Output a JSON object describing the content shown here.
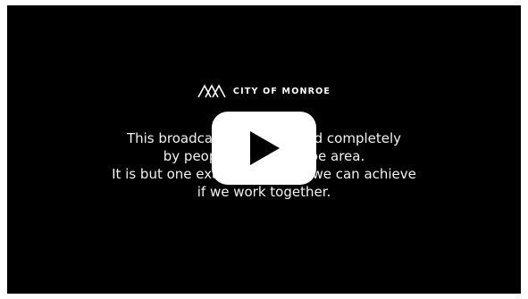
{
  "video": {
    "logo_text": "CITY OF MONROE",
    "logo_icon": "monroe-mountains-logo",
    "message_lines": [
      "This broadcast was produced completely",
      "by people in the Monroe area.",
      "It is but one example of what we can achieve",
      "if we work together."
    ],
    "play_icon": "play-icon",
    "colors": {
      "background": "#000000",
      "text": "#ffffff",
      "play_button": "#ffffff",
      "play_glyph": "#000000"
    }
  }
}
